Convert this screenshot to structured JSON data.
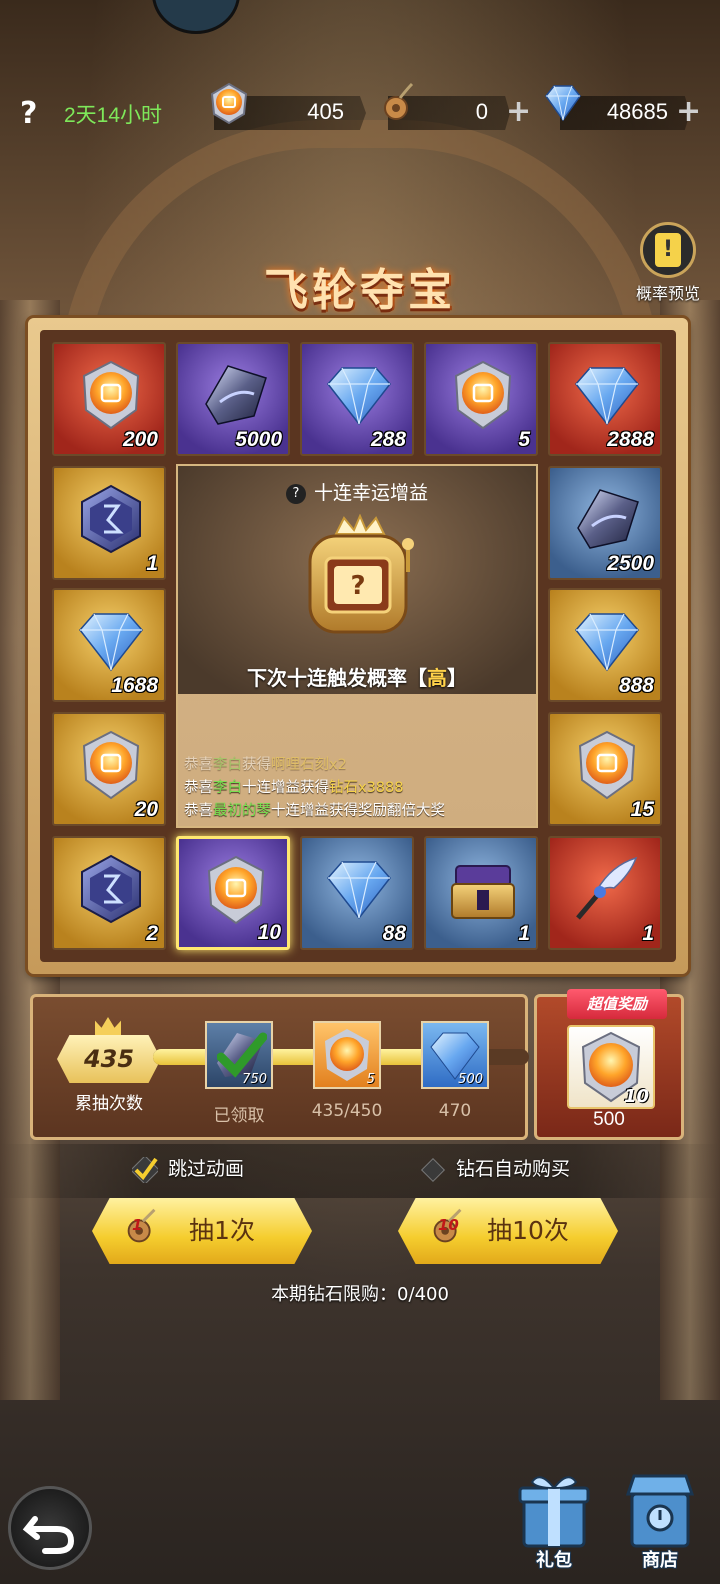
{
  "topbar": {
    "help": "?",
    "timer": "2天14小时",
    "resources": [
      {
        "icon": "orb-token-icon",
        "value": "405"
      },
      {
        "icon": "chain-key-icon",
        "value": "0"
      },
      {
        "icon": "diamond-icon",
        "value": "48685"
      }
    ],
    "plus": "+"
  },
  "title": "飞轮夺宝",
  "prob_preview": {
    "icon": "card-icon",
    "glyph": "!",
    "label": "概率预览"
  },
  "grid": [
    {
      "icon": "orb-token-icon",
      "count": "200",
      "bg": "red"
    },
    {
      "icon": "dark-crystal-icon",
      "count": "5000",
      "bg": "purple"
    },
    {
      "icon": "diamond-icon",
      "count": "288",
      "bg": "purple"
    },
    {
      "icon": "orb-token-icon",
      "count": "5",
      "bg": "purple"
    },
    {
      "icon": "diamond-icon",
      "count": "2888",
      "bg": "red"
    },
    {
      "icon": "rune-stone-icon",
      "count": "1",
      "bg": "gold"
    },
    {
      "icon": "dark-crystal-icon",
      "count": "2500",
      "bg": "blue"
    },
    {
      "icon": "diamond-icon",
      "count": "1688",
      "bg": "gold"
    },
    {
      "icon": "diamond-icon",
      "count": "888",
      "bg": "gold"
    },
    {
      "icon": "orb-token-icon",
      "count": "20",
      "bg": "gold"
    },
    {
      "icon": "orb-token-icon",
      "count": "15",
      "bg": "gold"
    },
    {
      "icon": "rune-stone-icon",
      "count": "2",
      "bg": "gold"
    },
    {
      "icon": "orb-token-icon",
      "count": "10",
      "bg": "purple"
    },
    {
      "icon": "diamond-icon",
      "count": "88",
      "bg": "blue"
    },
    {
      "icon": "treasure-chest-icon",
      "count": "1",
      "bg": "blue"
    },
    {
      "icon": "feather-blade-icon",
      "count": "1",
      "bg": "red"
    }
  ],
  "center": {
    "help": "?",
    "boost_title": "十连幸运增益",
    "slot_glyph": "?",
    "next_rate_prefix": "下次十连触发概率【",
    "next_rate_value": "高",
    "next_rate_suffix": "】",
    "feed": [
      {
        "prefix": "恭喜",
        "name": "李白",
        "mid": "获得",
        "reward": "啊哩石刻x2"
      },
      {
        "prefix": "恭喜",
        "name": "李白",
        "mid": "十连增益获得",
        "reward": "钻石x3888"
      },
      {
        "prefix": "恭喜",
        "name": "最初的琴",
        "mid": "十连增益获得奖励翻倍大奖",
        "reward": ""
      }
    ]
  },
  "progress": {
    "count": "435",
    "count_label": "累抽次数",
    "progress_fraction": 0.78,
    "milestones": [
      {
        "icon": "dark-crystal-icon",
        "qty": "750",
        "label": "已领取",
        "claimed": true
      },
      {
        "icon": "orb-token-icon",
        "qty": "5",
        "label": "435/450",
        "claimed": false
      },
      {
        "icon": "diamond-icon",
        "qty": "500",
        "label": "470",
        "claimed": false
      }
    ]
  },
  "bonus": {
    "tag": "超值奖励",
    "icon": "orb-token-icon",
    "qty": "10",
    "value": "500"
  },
  "options": {
    "skip_animation": "跳过动画",
    "auto_buy": "钻石自动购买"
  },
  "draw": [
    {
      "cost": "1",
      "label": "抽1次"
    },
    {
      "cost": "10",
      "label": "抽10次"
    }
  ],
  "limit": "本期钻石限购：0/400",
  "dock": {
    "gift": "礼包",
    "shop": "商店"
  },
  "colors": {
    "accent_gold": "#f5cd2e",
    "timer_green": "#7ee85a",
    "rate_high": "#ffd24a"
  }
}
